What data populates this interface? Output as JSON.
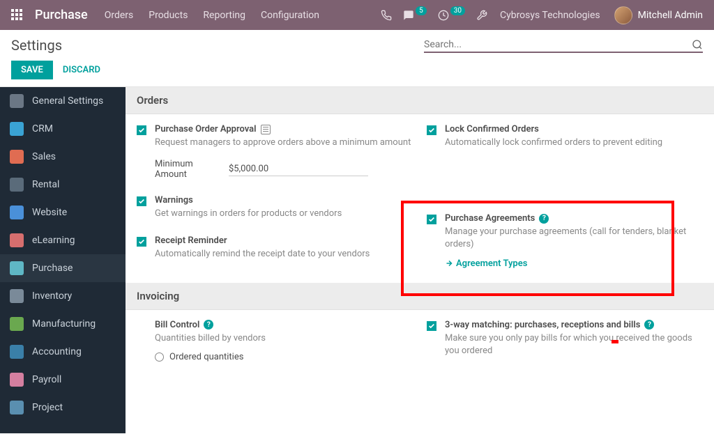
{
  "topnav": {
    "brand": "Purchase",
    "items": [
      "Orders",
      "Products",
      "Reporting",
      "Configuration"
    ],
    "msg_count": "5",
    "activity_count": "30",
    "company": "Cybrosys Technologies",
    "user": "Mitchell Admin"
  },
  "subbar": {
    "title": "Settings",
    "search_placeholder": "Search..."
  },
  "actions": {
    "save": "SAVE",
    "discard": "DISCARD"
  },
  "sidebar": {
    "items": [
      {
        "label": "General Settings",
        "icon": "ic-gear"
      },
      {
        "label": "CRM",
        "icon": "ic-crm"
      },
      {
        "label": "Sales",
        "icon": "ic-sales"
      },
      {
        "label": "Rental",
        "icon": "ic-rental"
      },
      {
        "label": "Website",
        "icon": "ic-website"
      },
      {
        "label": "eLearning",
        "icon": "ic-elearn"
      },
      {
        "label": "Purchase",
        "icon": "ic-purchase",
        "active": true
      },
      {
        "label": "Inventory",
        "icon": "ic-inventory"
      },
      {
        "label": "Manufacturing",
        "icon": "ic-mfg"
      },
      {
        "label": "Accounting",
        "icon": "ic-acct"
      },
      {
        "label": "Payroll",
        "icon": "ic-payroll"
      },
      {
        "label": "Project",
        "icon": "ic-project"
      }
    ]
  },
  "sections": {
    "orders": {
      "title": "Orders",
      "po_approval": {
        "title": "Purchase Order Approval",
        "desc": "Request managers to approve orders above a minimum amount",
        "field_label": "Minimum Amount",
        "field_value": "$5,000.00",
        "checked": true
      },
      "warnings": {
        "title": "Warnings",
        "desc": "Get warnings in orders for products or vendors",
        "checked": true
      },
      "receipt": {
        "title": "Receipt Reminder",
        "desc": "Automatically remind the receipt date to your vendors",
        "checked": true
      },
      "lock": {
        "title": "Lock Confirmed Orders",
        "desc": "Automatically lock confirmed orders to prevent editing",
        "checked": true
      },
      "agreements": {
        "title": "Purchase Agreements",
        "desc": "Manage your purchase agreements (call for tenders, blanket orders)",
        "link": "Agreement Types",
        "checked": true
      }
    },
    "invoicing": {
      "title": "Invoicing",
      "bill_control": {
        "title": "Bill Control",
        "desc": "Quantities billed by vendors",
        "radio1": "Ordered quantities"
      },
      "matching": {
        "title": "3-way matching: purchases, receptions and bills",
        "desc": "Make sure you only pay bills for which you received the goods you ordered",
        "checked": true
      }
    }
  }
}
